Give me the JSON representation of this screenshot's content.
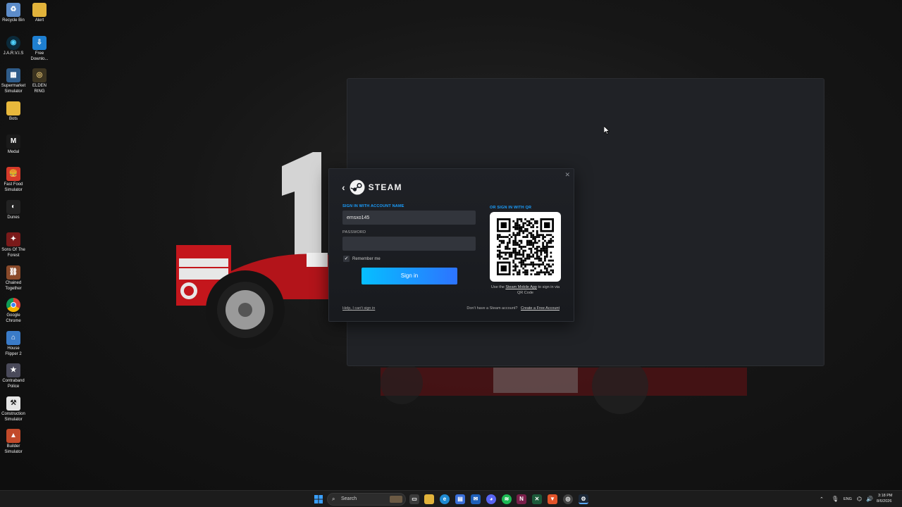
{
  "desktop": {
    "icons": [
      {
        "label": "Recycle Bin"
      },
      {
        "label": "Alert"
      },
      {
        "label": "J.A.R.V.I.S"
      },
      {
        "label": "Free Downlo..."
      },
      {
        "label": "Supermarket Simulator"
      },
      {
        "label": "ELDEN RING"
      },
      {
        "label": "Bots"
      },
      {
        "label": "Medal"
      },
      {
        "label": "Fast Food Simulator"
      },
      {
        "label": "Dunes"
      },
      {
        "label": "Sons Of The Forest"
      },
      {
        "label": "Chained Together"
      },
      {
        "label": "Google Chrome"
      },
      {
        "label": "House Flipper 2"
      },
      {
        "label": "Contraband Police"
      },
      {
        "label": "Construction Simulator"
      },
      {
        "label": "Builder Simulator"
      }
    ]
  },
  "login": {
    "brand": "STEAM",
    "account_label": "SIGN IN WITH ACCOUNT NAME",
    "account_value": "emsxo145",
    "password_label": "PASSWORD",
    "password_value": "",
    "remember_label": "Remember me",
    "remember_checked": true,
    "signin_label": "Sign in",
    "qr_label": "OR SIGN IN WITH QR",
    "qr_caption_pre": "Use the ",
    "qr_caption_link": "Steam Mobile App",
    "qr_caption_post": " to sign in via QR Code",
    "help_link": "Help, I can't sign in",
    "no_account_text": "Don't have a Steam account?",
    "create_account_link": "Create a Free Account",
    "accent_color": "#1a9fff"
  },
  "taskbar": {
    "search_placeholder": "Search",
    "language": "ENG",
    "time": "3:18 PM",
    "date": "8/6/2026"
  }
}
